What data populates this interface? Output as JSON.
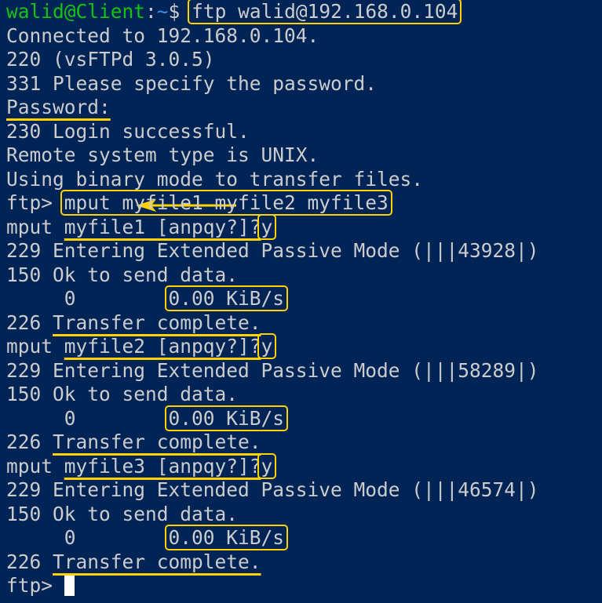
{
  "terminal": {
    "prompt_user_host": "walid@Client",
    "prompt_sep": ":",
    "prompt_path": "~",
    "prompt_symbol": "$ ",
    "command": "ftp walid@192.168.0.104",
    "lines": {
      "connected": "Connected to 192.168.0.104.",
      "r220": "220 (vsFTPd 3.0.5)",
      "r331": "331 Please specify the password.",
      "password_label": "Password:",
      "r230": "230 Login successful.",
      "remote_type": "Remote system type is UNIX.",
      "binary_mode": "Using binary mode to transfer files.",
      "ftp_prompt": "ftp> ",
      "mput_command": "mput myfile1 myfile2 myfile3"
    },
    "transfers": [
      {
        "mput_prefix": "mput ",
        "question": "myfile1 [anpqy?]?",
        "answer": "y",
        "passive": "229 Entering Extended Passive Mode (|||43928|)",
        "ok": "150 Ok to send data.",
        "bytes": "     0",
        "gap": "        ",
        "rate": "0.00 KiB/s",
        "code226": "226 ",
        "complete": "Transfer complete."
      },
      {
        "mput_prefix": "mput ",
        "question": "myfile2 [anpqy?]?",
        "answer": "y",
        "passive": "229 Entering Extended Passive Mode (|||58289|)",
        "ok": "150 Ok to send data.",
        "bytes": "     0",
        "gap": "        ",
        "rate": "0.00 KiB/s",
        "code226": "226 ",
        "complete": "Transfer complete."
      },
      {
        "mput_prefix": "mput ",
        "question": "myfile3 [anpqy?]?",
        "answer": "y",
        "passive": "229 Entering Extended Passive Mode (|||46574|)",
        "ok": "150 Ok to send data.",
        "bytes": "     0",
        "gap": "        ",
        "rate": "0.00 KiB/s",
        "code226": "226 ",
        "complete": "Transfer complete."
      }
    ],
    "final_prompt": "ftp> "
  },
  "colors": {
    "background": "#012456",
    "text": "#cccccc",
    "prompt_green": "#13c313",
    "prompt_blue": "#3b8eea",
    "annotation_yellow": "#ffd200"
  }
}
